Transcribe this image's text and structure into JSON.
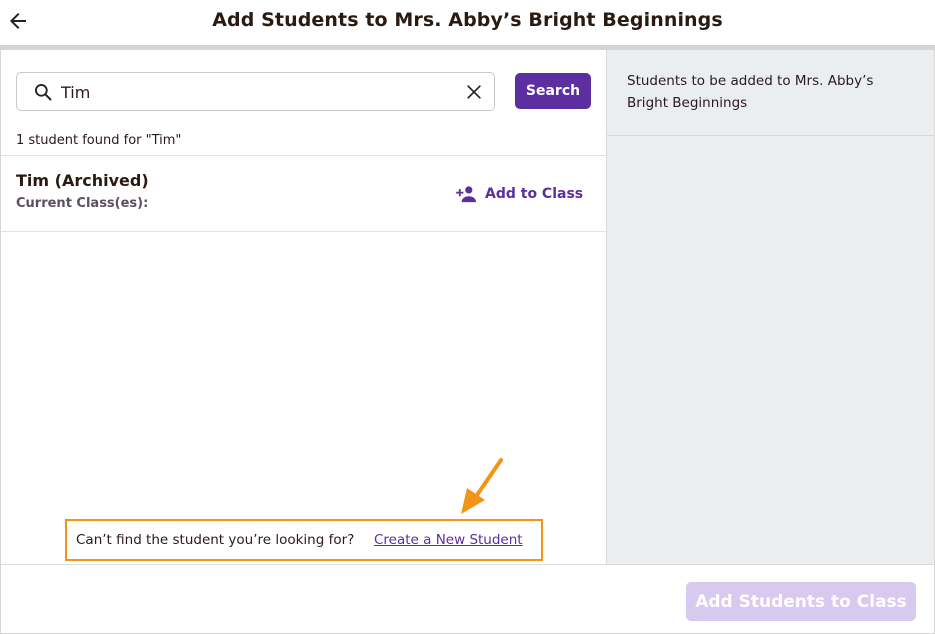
{
  "header": {
    "title": "Add Students to Mrs. Abby’s Bright Beginnings",
    "back_icon": "arrow-left-icon"
  },
  "search": {
    "value": "Tim",
    "button_label": "Search",
    "search_icon": "search-icon",
    "clear_icon": "close-icon"
  },
  "results": {
    "count_text": "1 student found for \"Tim\"",
    "students": [
      {
        "name": "Tim (Archived)",
        "classes_label": "Current Class(es):",
        "action_label": "Add to Class",
        "action_icon": "person-add-icon"
      }
    ]
  },
  "cant_find": {
    "text": "Can’t find the student you’re looking for?",
    "link_label": "Create a New Student"
  },
  "right_panel": {
    "heading": "Students to be added to Mrs. Abby’s Bright Beginnings"
  },
  "footer": {
    "submit_label": "Add Students to Class",
    "submit_enabled": false
  },
  "colors": {
    "accent": "#5c2ea0",
    "highlight": "#f29418",
    "disabled_button": "#d8c9ee",
    "right_panel_bg": "#ebeef1"
  }
}
